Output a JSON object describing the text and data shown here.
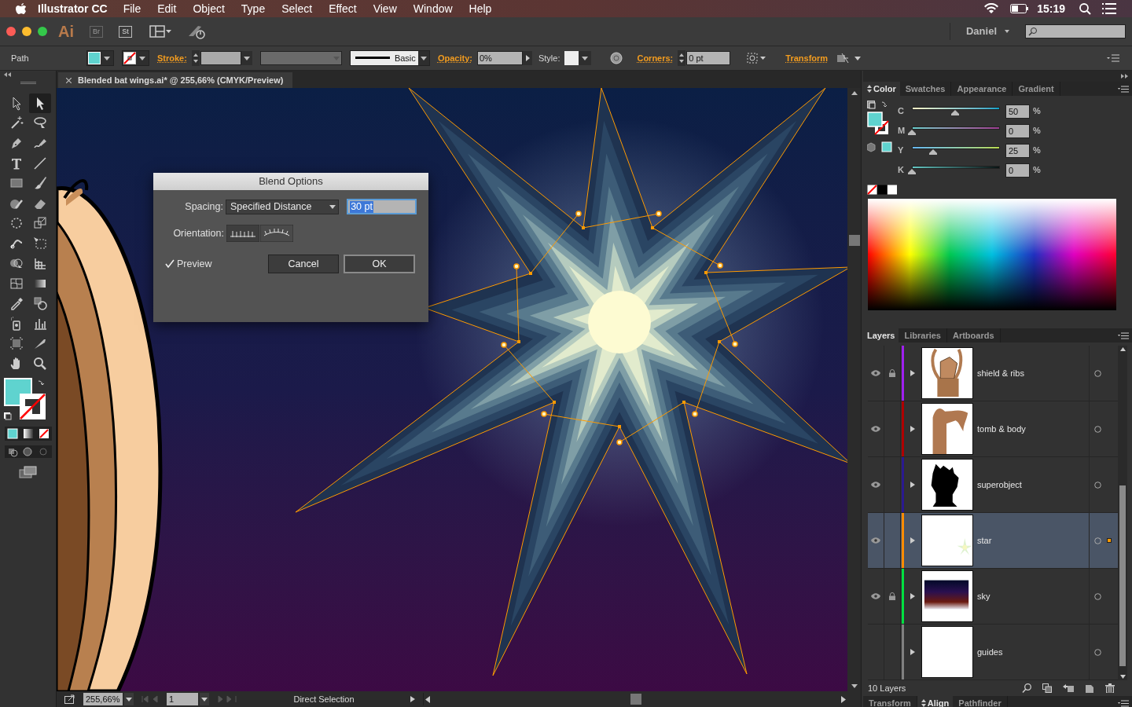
{
  "menu_bar": {
    "app_name": "Illustrator CC",
    "items": [
      "File",
      "Edit",
      "Object",
      "Type",
      "Select",
      "Effect",
      "View",
      "Window",
      "Help"
    ],
    "clock": "15:19"
  },
  "app_bar": {
    "app_logo": "Ai",
    "bridge_button": "Br",
    "stock_button": "St",
    "user": "Daniel"
  },
  "control_bar": {
    "selection_type": "Path",
    "stroke_label": "Stroke:",
    "brush": "Basic",
    "opacity_label": "Opacity:",
    "opacity": "0%",
    "style_label": "Style:",
    "corners_label": "Corners:",
    "corners": "0 pt",
    "transform_link": "Transform"
  },
  "document_tab": {
    "title": "Blended bat wings.ai* @ 255,66% (CMYK/Preview)"
  },
  "tools": [
    {
      "kind": "selection",
      "selected": false
    },
    {
      "kind": "direct",
      "selected": true
    },
    {
      "kind": "wand",
      "selected": false
    },
    {
      "kind": "lasso",
      "selected": false
    },
    {
      "kind": "pen",
      "selected": false
    },
    {
      "kind": "curvature",
      "selected": false
    },
    {
      "kind": "type",
      "selected": false
    },
    {
      "kind": "line",
      "selected": false
    },
    {
      "kind": "rect",
      "selected": false
    },
    {
      "kind": "brush",
      "selected": false
    },
    {
      "kind": "shaper",
      "selected": false
    },
    {
      "kind": "eraser",
      "selected": false
    },
    {
      "kind": "rotate",
      "selected": false
    },
    {
      "kind": "scale",
      "selected": false
    },
    {
      "kind": "puppet",
      "selected": false
    },
    {
      "kind": "freetransform",
      "selected": false
    },
    {
      "kind": "shapebuilder",
      "selected": false
    },
    {
      "kind": "perspective",
      "selected": false
    },
    {
      "kind": "mesh",
      "selected": false
    },
    {
      "kind": "gradient",
      "selected": false
    },
    {
      "kind": "eyedropper",
      "selected": false
    },
    {
      "kind": "blend",
      "selected": false
    },
    {
      "kind": "sprayer",
      "selected": false
    },
    {
      "kind": "graph",
      "selected": false
    },
    {
      "kind": "artboard",
      "selected": false
    },
    {
      "kind": "slice",
      "selected": false
    },
    {
      "kind": "hand",
      "selected": false
    },
    {
      "kind": "zoom",
      "selected": false
    }
  ],
  "blend_options": {
    "title": "Blend Options",
    "spacing_label": "Spacing:",
    "spacing_mode": "Specified Distance",
    "spacing_value": "30 pt",
    "orientation_label": "Orientation:",
    "preview": {
      "label": "Preview",
      "checked": true
    },
    "buttons": [
      {
        "label": "Cancel",
        "default": false
      },
      {
        "label": "OK",
        "default": true
      }
    ]
  },
  "status_bar": {
    "zoom": "255,66%",
    "artboard": "1",
    "current_tool": "Direct Selection"
  },
  "color_panel": {
    "tabs": [
      {
        "label": "Color",
        "selected": true
      },
      {
        "label": "Swatches",
        "selected": false
      },
      {
        "label": "Appearance",
        "selected": false
      },
      {
        "label": "Gradient",
        "selected": false
      }
    ],
    "channels": [
      {
        "label": "C",
        "kind": "cyan",
        "level": 0.49,
        "value": "50",
        "unit": "%"
      },
      {
        "label": "M",
        "kind": "magenta",
        "level": 0,
        "value": "0",
        "unit": "%"
      },
      {
        "label": "Y",
        "kind": "yellow",
        "level": 0.24,
        "value": "25",
        "unit": "%"
      },
      {
        "label": "K",
        "kind": "black",
        "level": 0,
        "value": "0",
        "unit": "%"
      }
    ]
  },
  "layers_panel": {
    "tabs": [
      {
        "label": "Layers",
        "selected": true
      },
      {
        "label": "Libraries",
        "selected": false
      },
      {
        "label": "Artboards",
        "selected": false
      }
    ],
    "layers": [
      {
        "name": "shield & ribs",
        "kind": "figure",
        "visible": true,
        "locked": true,
        "color": "#a020f0",
        "selected": false,
        "has_selection": false
      },
      {
        "name": "tomb & body",
        "kind": "body",
        "visible": true,
        "locked": false,
        "color": "#b00000",
        "selected": false,
        "has_selection": false
      },
      {
        "name": "superobject",
        "kind": "silhouette",
        "visible": true,
        "locked": false,
        "color": "#2a1a90",
        "selected": false,
        "has_selection": false
      },
      {
        "name": "star",
        "kind": "star",
        "visible": true,
        "locked": false,
        "color": "#ff8c00",
        "selected": true,
        "has_selection": true
      },
      {
        "name": "sky",
        "kind": "sky",
        "visible": true,
        "locked": true,
        "color": "#00e040",
        "selected": false,
        "has_selection": false
      },
      {
        "name": "guides",
        "kind": "blank",
        "visible": false,
        "locked": false,
        "color": "#808080",
        "selected": false,
        "has_selection": false
      }
    ],
    "count": "10 Layers"
  },
  "bottom_panel": {
    "tabs": [
      {
        "label": "Transform",
        "selected": false
      },
      {
        "label": "Align",
        "selected": true
      },
      {
        "label": "Pathfinder",
        "selected": false
      }
    ]
  }
}
